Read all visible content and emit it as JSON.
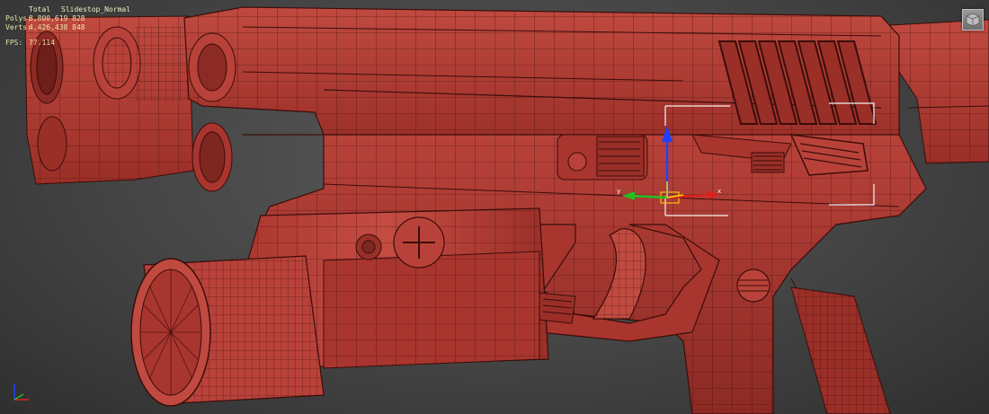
{
  "viewport": {
    "stats": {
      "total_label": "Total",
      "object_name": "Slidestop_Normal",
      "polys_label": "Polys:",
      "polys_value": "8,800,619 828",
      "verts_label": "Verts:",
      "verts_value": "4,426,438 848",
      "fps_label": "FPS:",
      "fps_value": "77.114"
    },
    "gizmo": {
      "x_label": "x",
      "y_label": "y"
    },
    "colors": {
      "mesh": "#b8423a",
      "mesh_dark": "#7e2721",
      "wire": "#3b0d0a",
      "stats_text": "#e8e6a8",
      "axis_x": "#e02020",
      "axis_y": "#20c020",
      "axis_z": "#2040ff",
      "selection": "#f2f2f2",
      "gizmo_plane": "#ffdd00"
    },
    "icons": [
      "viewcube-icon",
      "axis-tripod-icon",
      "transform-gizmo-icon"
    ]
  }
}
